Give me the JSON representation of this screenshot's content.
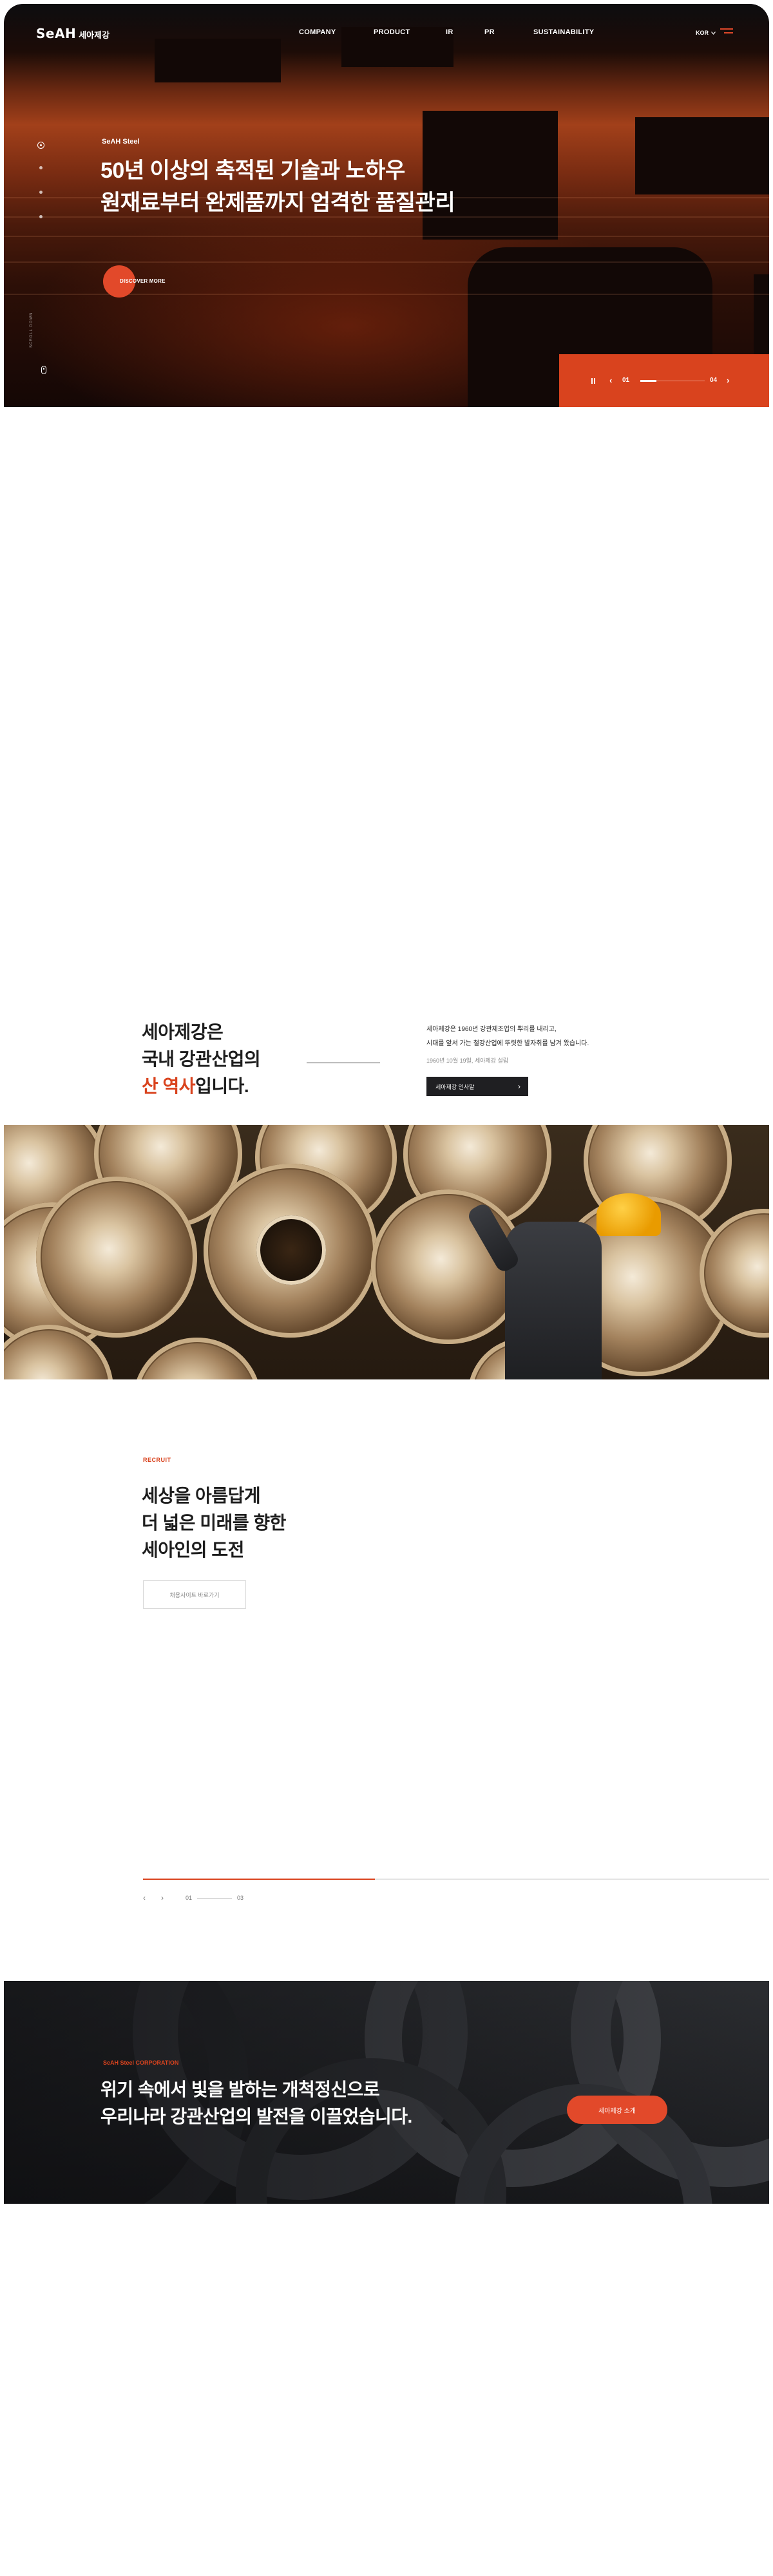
{
  "header": {
    "logo_mark": "SeAH",
    "logo_sub": "세아제강",
    "nav": [
      "COMPANY",
      "PRODUCT",
      "IR",
      "PR",
      "SUSTAINABILITY"
    ],
    "lang": "KOR",
    "lang_icon": "chevron-down-icon",
    "menu_icon": "hamburger-menu-icon"
  },
  "hero": {
    "kicker": "SeAH Steel",
    "title_line1": "50년 이상의 축적된 기술과 노하우",
    "title_line2": "원재료부터 완제품까지 엄격한 품질관리",
    "discover": "DISCOVER MORE",
    "scroll": "SCROLL DOWN",
    "slide_current": "01",
    "slide_total": "04",
    "slide_progress": 0.25,
    "accent_color": "#d9431e"
  },
  "intro": {
    "title_line1": "세아제강은",
    "title_line2": "국내 강관산업의",
    "title_accent": "산 역사",
    "title_suffix": "입니다.",
    "desc_line1": "세아제강은 1960년 강관제조업의 뿌리를 내리고,",
    "desc_line2": "시대를 앞서 가는 철강산업에 뚜렷한 발자취를 남겨 왔습니다.",
    "date": "1960년 10월 19일, 세아제강 설립",
    "button": "세아제강 인사말"
  },
  "recruit": {
    "kicker": "RECRUIT",
    "title_line1": "세상을 아름답게",
    "title_line2": "더 넓은 미래를 향한",
    "title_line3": "세아인의 도전",
    "button": "채용사이트 바로가기",
    "slide_current": "01",
    "slide_total": "03",
    "slide_progress": 0.37
  },
  "corporation": {
    "kicker": "SeAH Steel CORPORATION",
    "title_line1": "위기 속에서 빛을 발하는 개척정신으로",
    "title_line2": "우리나라 강관산업의 발전을 이끌었습니다.",
    "button": "세아제강 소개"
  }
}
